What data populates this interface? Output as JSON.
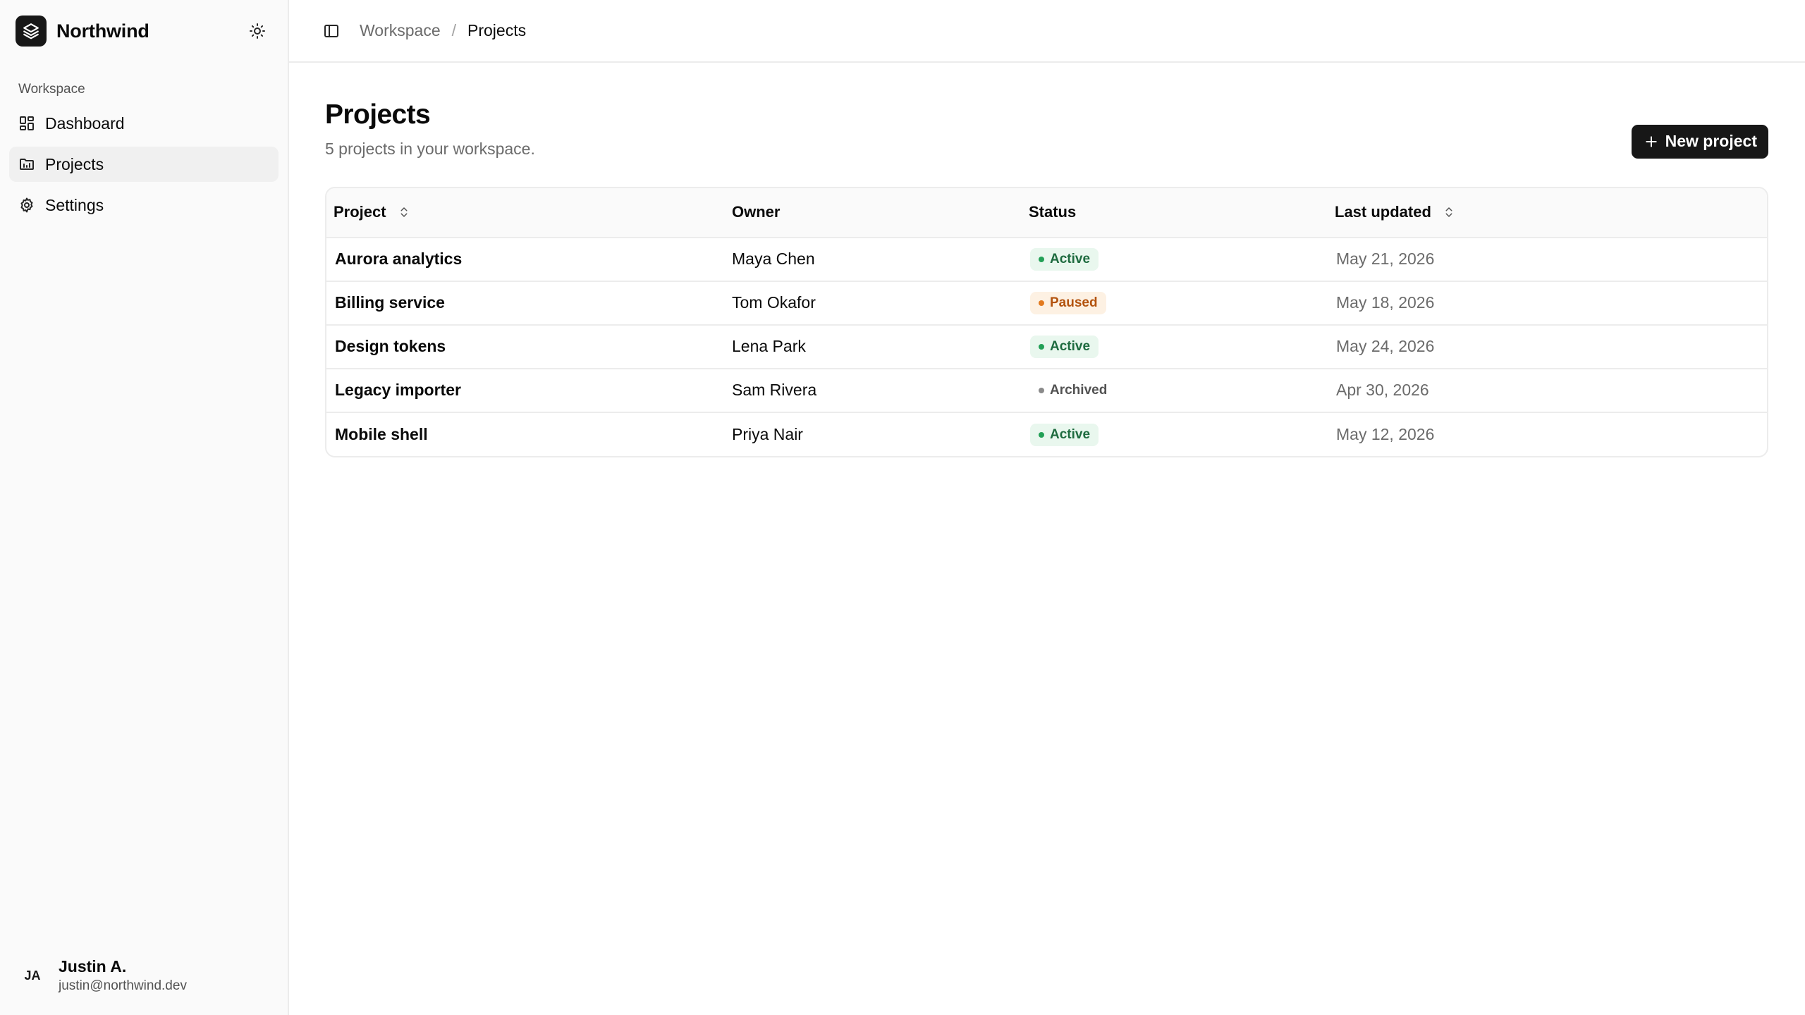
{
  "brand": {
    "name": "Northwind"
  },
  "sidebar": {
    "section_label": "Workspace",
    "items": [
      {
        "label": "Dashboard",
        "icon": "dashboard-icon",
        "active": false
      },
      {
        "label": "Projects",
        "icon": "folder-icon",
        "active": true
      },
      {
        "label": "Settings",
        "icon": "gear-icon",
        "active": false
      }
    ],
    "user": {
      "initials": "JA",
      "name": "Justin A.",
      "email": "justin@northwind.dev"
    }
  },
  "breadcrumb": {
    "parent": "Workspace",
    "separator": "/",
    "current": "Projects"
  },
  "page": {
    "title": "Projects",
    "subtitle": "5 projects in your workspace.",
    "new_button_label": "New project"
  },
  "table": {
    "columns": {
      "project": "Project",
      "owner": "Owner",
      "status": "Status",
      "updated": "Last updated"
    },
    "rows": [
      {
        "project": "Aurora analytics",
        "owner": "Maya Chen",
        "status": "Active",
        "status_kind": "active",
        "updated": "May 21, 2026"
      },
      {
        "project": "Billing service",
        "owner": "Tom Okafor",
        "status": "Paused",
        "status_kind": "paused",
        "updated": "May 18, 2026"
      },
      {
        "project": "Design tokens",
        "owner": "Lena Park",
        "status": "Active",
        "status_kind": "active",
        "updated": "May 24, 2026"
      },
      {
        "project": "Legacy importer",
        "owner": "Sam Rivera",
        "status": "Archived",
        "status_kind": "archived",
        "updated": "Apr 30, 2026"
      },
      {
        "project": "Mobile shell",
        "owner": "Priya Nair",
        "status": "Active",
        "status_kind": "active",
        "updated": "May 12, 2026"
      }
    ]
  },
  "colors": {
    "primary": "#171717",
    "active": "#22a056",
    "paused": "#e27a1f",
    "archived": "#8a8a8a"
  }
}
